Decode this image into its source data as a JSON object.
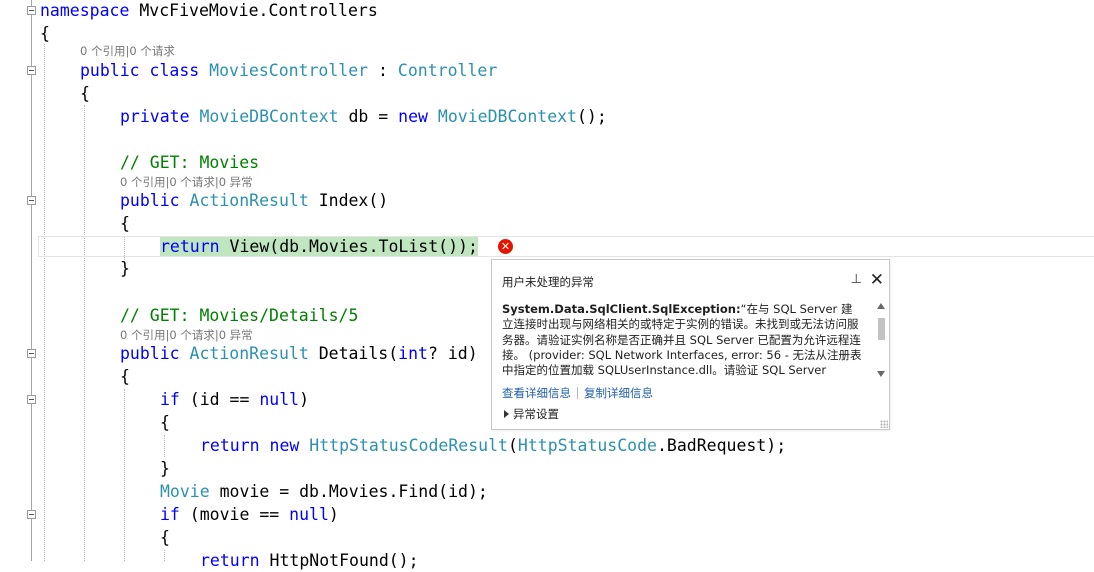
{
  "code": {
    "namespace_kw": "namespace",
    "namespace_name": " MvcFiveMovie.Controllers",
    "open_brace": "{",
    "close_brace": "}",
    "lens_class": "0 个引用|0 个请求",
    "class_public": "public",
    "class_kw": " class ",
    "class_name": "MoviesController",
    "class_colon": " : ",
    "class_base": "Controller",
    "field_private": "private ",
    "field_type": "MovieDBContext",
    "field_mid": " db = ",
    "field_new": "new ",
    "field_type2": "MovieDBContext",
    "field_end": "();",
    "comment_index": "// GET: Movies",
    "lens_index": "0 个引用|0 个请求|0 异常",
    "index_public": "public ",
    "index_type": "ActionResult",
    "index_name": " Index()",
    "return_kw": "return",
    "return_rest": " View(db.Movies.ToList());",
    "comment_details": "// GET: Movies/Details/5",
    "lens_details": "0 个引用|0 个请求|0 异常",
    "details_public": "public ",
    "details_type": "ActionResult",
    "details_name": " Details(",
    "details_int": "int",
    "details_param": "? id)",
    "if_kw": "if",
    "if1_cond": " (id == ",
    "null_kw": "null",
    "paren_close": ")",
    "return_new_kw": "return new ",
    "httpstatus_result": "HttpStatusCodeResult",
    "paren_open": "(",
    "httpstatus_code": "HttpStatusCode",
    "bad_request": ".BadRequest);",
    "movie_type": "Movie",
    "movie_find": " movie = db.Movies.Find(id);",
    "if2_cond": " (movie == ",
    "return_notfound_kw": "return",
    "notfound_rest": " HttpNotFound();"
  },
  "exception_popup": {
    "title": "用户未处理的异常",
    "exception_type": "System.Data.SqlClient.SqlException:",
    "message": "“在与 SQL Server 建立连接时出现与网络相关的或特定于实例的错误。未找到或无法访问服务器。请验证实例名称是否正确并且 SQL Server 已配置为允许远程连接。 (provider: SQL Network Interfaces, error: 56 - 无法从注册表中指定的位置加载 SQLUserInstance.dll。请验证 SQL Server",
    "link_view_details": "查看详细信息",
    "link_copy_details": "复制详细信息",
    "settings_label": "异常设置"
  },
  "colors": {
    "keyword": "#0000ff",
    "type": "#2b91af",
    "comment": "#008000",
    "error": "#e51400",
    "highlight": "#bfe6bf",
    "link": "#1f5eab"
  },
  "icons": [
    "fold-toggle-icon",
    "error-icon",
    "pin-icon",
    "close-icon",
    "scroll-up-icon",
    "scroll-down-icon",
    "expand-icon"
  ]
}
